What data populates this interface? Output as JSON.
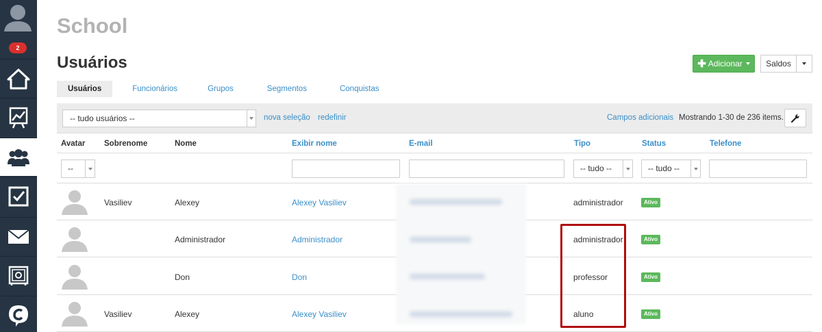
{
  "app": {
    "school_title": "School",
    "page_title": "Usuários",
    "notification_count": "2"
  },
  "sidebar": {
    "items": [
      {
        "icon": "home-icon"
      },
      {
        "icon": "chart-icon"
      },
      {
        "icon": "users-icon",
        "active": true
      },
      {
        "icon": "checkbox-icon"
      },
      {
        "icon": "mail-icon"
      },
      {
        "icon": "safe-icon"
      },
      {
        "icon": "chat-logo-icon"
      }
    ]
  },
  "toolbar": {
    "add_label": "Adicionar",
    "saldos_label": "Saldos"
  },
  "tabs": [
    {
      "label": "Usuários",
      "active": true
    },
    {
      "label": "Funcionários"
    },
    {
      "label": "Grupos"
    },
    {
      "label": "Segmentos"
    },
    {
      "label": "Conquistas"
    }
  ],
  "filter": {
    "selection_value": "-- tudo usuários --",
    "new_selection": "nova seleção",
    "reset": "redefinir",
    "extra_fields": "Campos adicionais",
    "showing": "Mostrando 1-30 de 236 items."
  },
  "table": {
    "headers": {
      "avatar": "Avatar",
      "surname": "Sobrenome",
      "name": "Nome",
      "display_name": "Exibir nome",
      "email": "E-mail",
      "type": "Tipo",
      "status": "Status",
      "phone": "Telefone"
    },
    "filters": {
      "avatar": "--",
      "type": "-- tudo --",
      "status": "-- tudo --"
    },
    "rows": [
      {
        "surname": "Vasiliev",
        "name": "Alexey",
        "display_name": "Alexey Vasiliev",
        "type": "administrador",
        "status": "Ativo"
      },
      {
        "surname": "",
        "name": "Administrador",
        "display_name": "Administrador",
        "type": "administrador",
        "status": "Ativo"
      },
      {
        "surname": "",
        "name": "Don",
        "display_name": "Don",
        "type": "professor",
        "status": "Ativo"
      },
      {
        "surname": "Vasiliev",
        "name": "Alexey",
        "display_name": "Alexey Vasiliev",
        "type": "aluno",
        "status": "Ativo"
      }
    ]
  },
  "colors": {
    "sidebar": "#263443",
    "accent_link": "#3a8fc8",
    "success": "#5cb85c",
    "badge": "#d9302e",
    "highlight": "#b00d0d"
  }
}
